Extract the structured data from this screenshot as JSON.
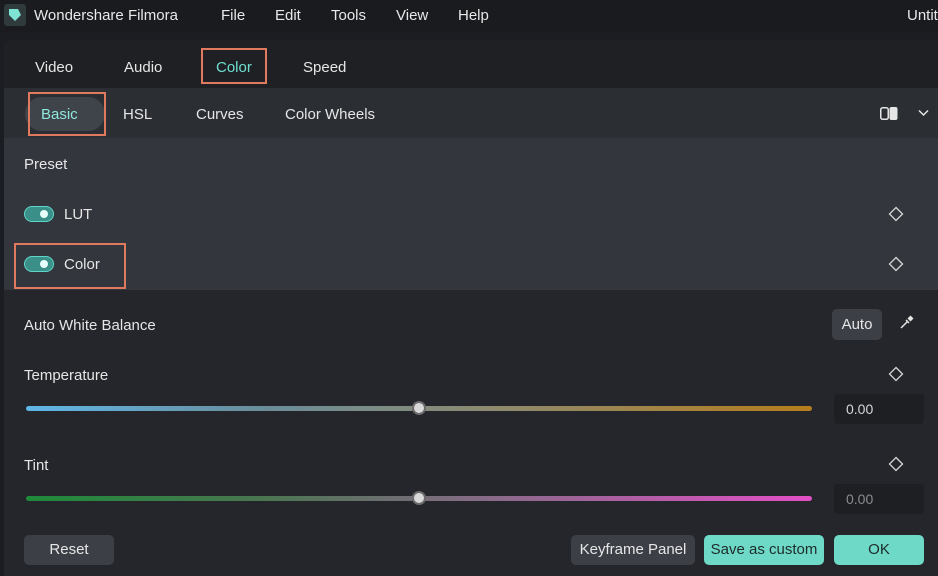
{
  "titlebar": {
    "app_name": "Wondershare Filmora",
    "menu": [
      "File",
      "Edit",
      "Tools",
      "View",
      "Help"
    ],
    "document_title": "Untitled"
  },
  "tabs": {
    "video": "Video",
    "audio": "Audio",
    "color": "Color",
    "speed": "Speed",
    "active": "Color"
  },
  "subtabs": {
    "basic": "Basic",
    "hsl": "HSL",
    "curves": "Curves",
    "color_wheels": "Color Wheels",
    "active": "Basic"
  },
  "preset": {
    "title": "Preset",
    "lut": {
      "label": "LUT",
      "enabled": true
    },
    "color": {
      "label": "Color",
      "enabled": true
    }
  },
  "white_balance": {
    "label": "Auto White Balance",
    "auto_label": "Auto"
  },
  "temperature": {
    "label": "Temperature",
    "value": "0.00",
    "level": 0.5
  },
  "tint": {
    "label": "Tint",
    "value": "0.00",
    "level": 0.5
  },
  "buttons": {
    "reset": "Reset",
    "keyframe_panel": "Keyframe Panel",
    "save_custom": "Save as custom",
    "ok": "OK"
  },
  "colors": {
    "accent": "#6fd9c7",
    "highlight": "#e07a5f"
  },
  "icons": [
    "filmora-logo-icon",
    "compare-view-icon",
    "chevron-down-icon",
    "keyframe-diamond-icon",
    "eyedropper-icon"
  ]
}
